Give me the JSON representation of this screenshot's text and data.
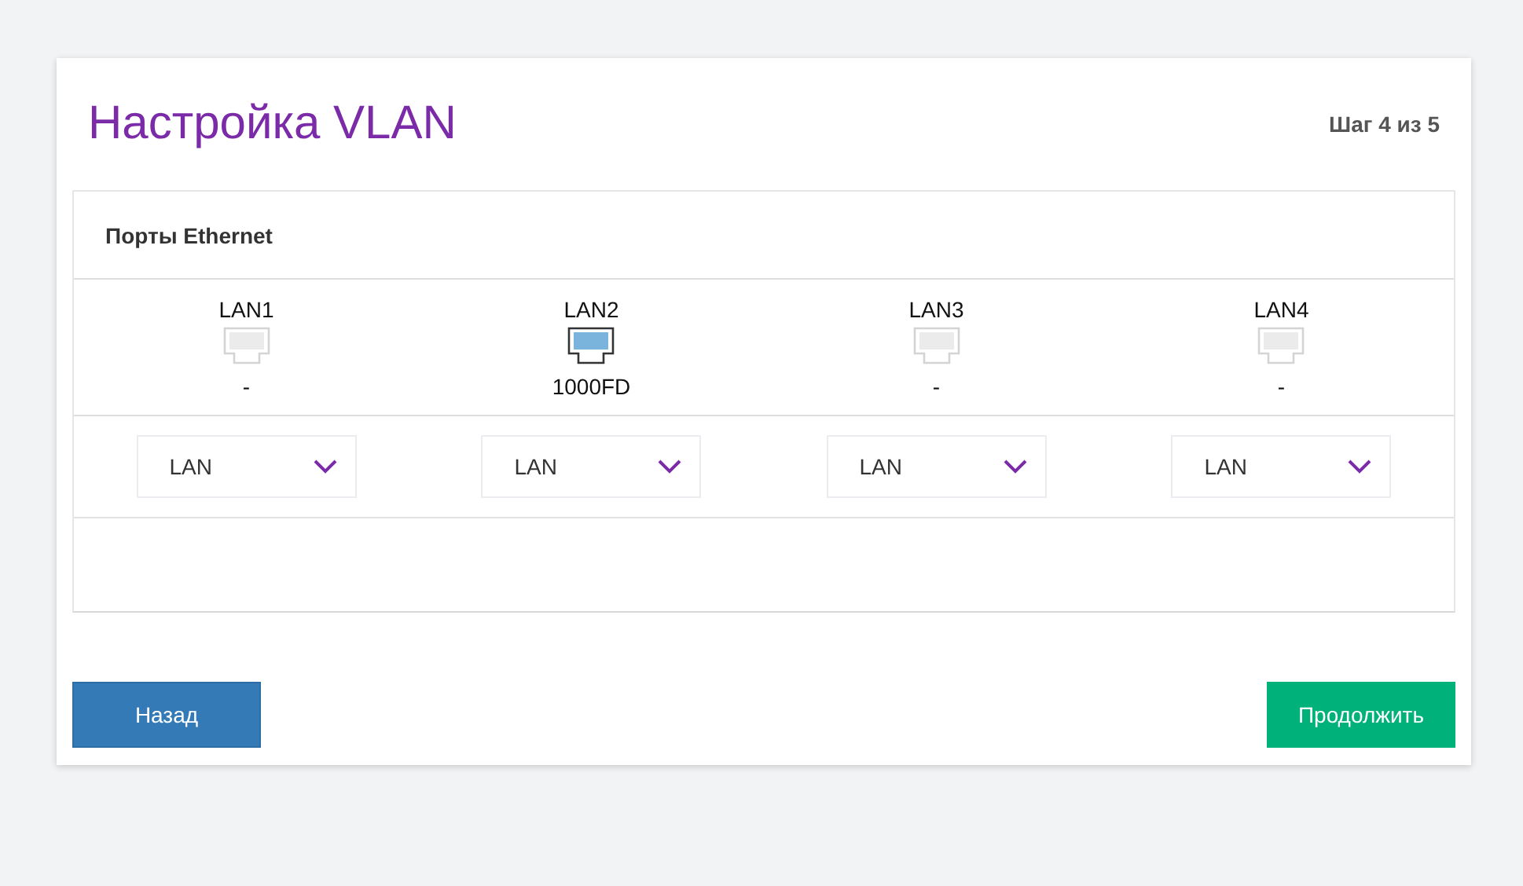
{
  "title": "Настройка VLAN",
  "step": "Шаг 4 из 5",
  "panel": {
    "heading": "Порты Ethernet",
    "ports": [
      {
        "name": "LAN1",
        "connected": false,
        "speed": "-",
        "mode": "LAN"
      },
      {
        "name": "LAN2",
        "connected": true,
        "speed": "1000FD",
        "mode": "LAN"
      },
      {
        "name": "LAN3",
        "connected": false,
        "speed": "-",
        "mode": "LAN"
      },
      {
        "name": "LAN4",
        "connected": false,
        "speed": "-",
        "mode": "LAN"
      }
    ]
  },
  "buttons": [
    {
      "label": "Назад",
      "kind": "back"
    },
    {
      "label": "Продолжить",
      "kind": "next"
    }
  ]
}
